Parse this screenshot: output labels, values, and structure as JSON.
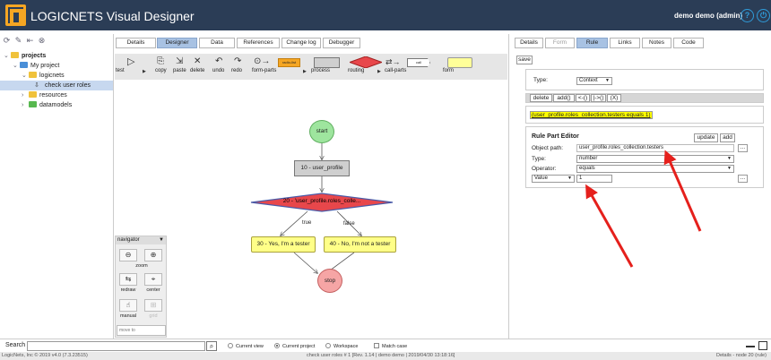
{
  "header": {
    "app_title": "LOGICNETS Visual Designer",
    "user": "demo demo (admin)",
    "help_icon": "?",
    "power_icon": "⏻"
  },
  "left": {
    "tree": [
      {
        "label": "projects",
        "level": 0,
        "icon": "folder",
        "expanded": true,
        "bold": true
      },
      {
        "label": "My project",
        "level": 1,
        "icon": "folder-blue",
        "expanded": true
      },
      {
        "label": "logicnets",
        "level": 2,
        "icon": "folder",
        "expanded": true
      },
      {
        "label": "check user roles",
        "level": 3,
        "icon": "download",
        "selected": true
      },
      {
        "label": "resources",
        "level": 2,
        "icon": "folder",
        "expanded": false
      },
      {
        "label": "datamodels",
        "level": 2,
        "icon": "folder-green",
        "expanded": false
      }
    ]
  },
  "center_tabs": [
    "Details",
    "Designer",
    "Data",
    "References",
    "Change log",
    "Debugger"
  ],
  "center_active_tab": "Designer",
  "palette": {
    "labels": [
      "test",
      "copy",
      "paste",
      "delete",
      "undo",
      "redo",
      "form-parts",
      "process",
      "routing",
      "call-parts",
      "form"
    ],
    "form_parts_tag": "radio-list",
    "call_tag": "call"
  },
  "flow": {
    "start": "start",
    "process": "10 - user_profile",
    "decision": "20 - 'user_profile.roles_colle...",
    "true_label": "true",
    "false_label": "false",
    "yes": "30 - Yes, I'm a tester",
    "no": "40 - No, I'm not a tester",
    "stop": "stop"
  },
  "navigator": {
    "title": "navigator",
    "zoom": "zoom",
    "redraw": "redraw",
    "center": "center",
    "manual": "manual",
    "grid": "grid",
    "move_to": "move to"
  },
  "right_tabs": [
    "Details",
    "Form",
    "Rule",
    "Links",
    "Notes",
    "Code"
  ],
  "right_active_tab": "Rule",
  "rule": {
    "save": "save",
    "type_label": "Type:",
    "type_value": "Context",
    "buttons": [
      "delete",
      "add()",
      "<-()",
      "|->()",
      "(X)"
    ],
    "expression": "(user_profile.roles_collection.testers equals 1)",
    "editor_title": "Rule Part Editor",
    "update": "update",
    "add": "add",
    "object_path_label": "Object path:",
    "object_path": "user_profile.roles_collection.testers",
    "type2_label": "Type:",
    "type2": "number",
    "operator_label": "Operator:",
    "operator": "equals",
    "value_select": "Value",
    "value": "1",
    "ellipsis": "..."
  },
  "search": {
    "label": "Search",
    "options": [
      "Current view",
      "Current project",
      "Workspace"
    ],
    "selected": "Current project",
    "match_case": "Match case"
  },
  "status": {
    "left": "LogicNets, Inc © 2019 v4.0 (7.3.23515)",
    "center": "check user roles # 1 [Rev. 1.14 | demo demo | 2019/04/30 13:18:16]",
    "right": "Details - node 20 (rule)"
  },
  "colors": {
    "header": "#2b3d56",
    "accent": "#f5a623",
    "active_tab": "#a8c2e3",
    "start": "#9ee59e",
    "stop": "#f6a5a5",
    "decision": "#e8474b",
    "yes_no": "#ffff88",
    "arrow": "#e5201c"
  }
}
